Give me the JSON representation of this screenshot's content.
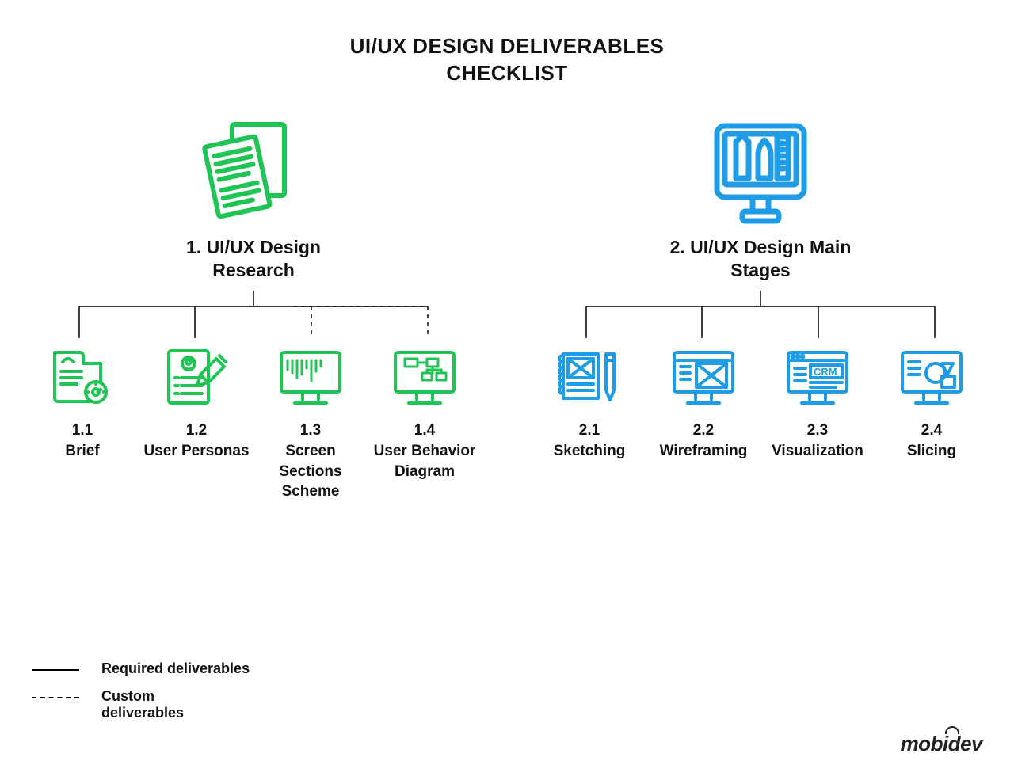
{
  "title_line1": "UI/UX DESIGN DELIVERABLES",
  "title_line2": "CHECKLIST",
  "colors": {
    "green": "#1FC455",
    "blue": "#1F9CE6",
    "text": "#111111"
  },
  "categories": [
    {
      "icon": "documents",
      "title": "1. UI/UX Design Research",
      "items": [
        {
          "icon": "brief",
          "num": "1.1",
          "label": "Brief",
          "style": "required"
        },
        {
          "icon": "persona",
          "num": "1.2",
          "label": "User Personas",
          "style": "required"
        },
        {
          "icon": "sections",
          "num": "1.3",
          "label": "Screen Sections Scheme",
          "style": "custom"
        },
        {
          "icon": "behavior",
          "num": "1.4",
          "label": "User Behavior Diagram",
          "style": "custom"
        }
      ]
    },
    {
      "icon": "design-tools",
      "title": "2. UI/UX Design Main Stages",
      "items": [
        {
          "icon": "sketch",
          "num": "2.1",
          "label": "Sketching",
          "style": "required"
        },
        {
          "icon": "wireframe",
          "num": "2.2",
          "label": "Wireframing",
          "style": "required"
        },
        {
          "icon": "visualization",
          "num": "2.3",
          "label": "Visualization",
          "style": "required"
        },
        {
          "icon": "slicing",
          "num": "2.4",
          "label": "Slicing",
          "style": "required"
        }
      ]
    }
  ],
  "legend": {
    "required": "Required deliverables",
    "custom": "Custom deliverables"
  },
  "brand": "mobidev",
  "icon_label_text": {
    "crm": "CRM"
  }
}
